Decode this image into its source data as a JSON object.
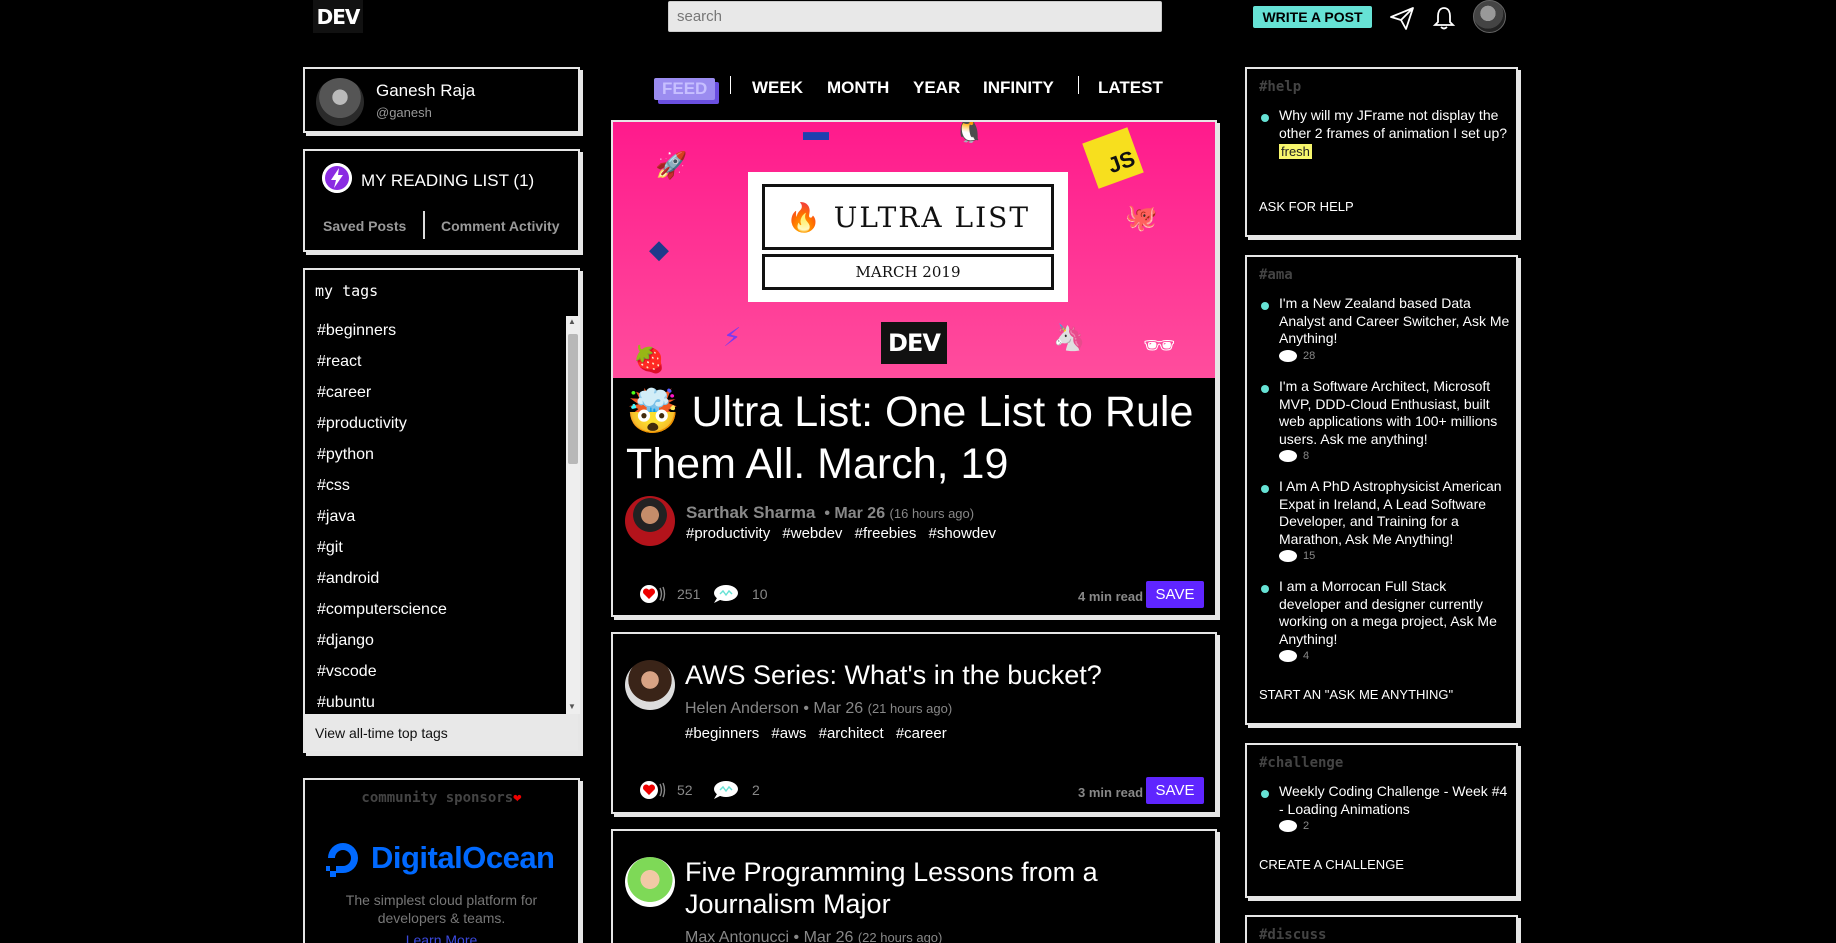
{
  "topbar": {
    "logo": "DEV",
    "search_placeholder": "search",
    "write_post": "WRITE A POST",
    "icons": [
      "paper-plane-icon",
      "bell-icon",
      "avatar"
    ]
  },
  "profile": {
    "name": "Ganesh Raja",
    "handle": "@ganesh"
  },
  "reading_list": {
    "title": "MY READING LIST (1)",
    "tabs": [
      "Saved Posts",
      "Comment Activity"
    ]
  },
  "tags": {
    "header": "my tags",
    "items": [
      "#beginners",
      "#react",
      "#career",
      "#productivity",
      "#python",
      "#css",
      "#java",
      "#git",
      "#android",
      "#computerscience",
      "#django",
      "#vscode",
      "#ubuntu"
    ],
    "footer": "View all-time top tags"
  },
  "sponsor": {
    "header": "community sponsors",
    "brand": "DigitalOcean",
    "description_line1": "The simplest cloud platform for",
    "description_line2": "developers & teams.",
    "link": "Learn More"
  },
  "feed_nav": [
    "FEED",
    "WEEK",
    "MONTH",
    "YEAR",
    "INFINITY",
    "LATEST"
  ],
  "banner": {
    "title": "ULTRA LIST",
    "subtitle": "MARCH 2019",
    "badge": "DEV",
    "js": "JS"
  },
  "articles": [
    {
      "title": "🤯 Ultra List: One List to Rule Them All. March, 19",
      "author": "Sarthak Sharma",
      "date": "• Mar 26",
      "ago": "(16 hours ago)",
      "tags": [
        "#productivity",
        "#webdev",
        "#freebies",
        "#showdev"
      ],
      "reactions": "251",
      "comments": "10",
      "read_time": "4 min read",
      "save": "SAVE"
    },
    {
      "title": "AWS Series: What's in the bucket?",
      "author": "Helen Anderson",
      "date": "• Mar 26",
      "ago": "(21 hours ago)",
      "tags": [
        "#beginners",
        "#aws",
        "#architect",
        "#career"
      ],
      "reactions": "52",
      "comments": "2",
      "read_time": "3 min read",
      "save": "SAVE"
    },
    {
      "title": "Five Programming Lessons from a Journalism Major",
      "author": "Max Antonucci",
      "date": "• Mar 26",
      "ago": "(22 hours ago)"
    }
  ],
  "sidebar": {
    "help": {
      "header": "#help",
      "items": [
        {
          "text": "Why will my JFrame not display the other 2 frames of animation I set up?",
          "badge": "fresh"
        }
      ],
      "cta": "ASK FOR HELP"
    },
    "ama": {
      "header": "#ama",
      "items": [
        {
          "text": "I'm a New Zealand based Data Analyst and Career Switcher, Ask Me Anything!",
          "count": "28"
        },
        {
          "text": "I'm a Software Architect, Microsoft MVP, DDD-Cloud Enthusiast, built web applications with 100+ millions users. Ask me anything!",
          "count": "8"
        },
        {
          "text": "I Am A PhD Astrophysicist American Expat in Ireland, A Lead Software Developer, and Training for a Marathon, Ask Me Anything!",
          "count": "15"
        },
        {
          "text": "I am a Morrocan Full Stack developer and designer currently working on a mega project, Ask Me Anything!",
          "count": "4"
        }
      ],
      "cta": "START AN \"ASK ME ANYTHING\""
    },
    "challenge": {
      "header": "#challenge",
      "items": [
        {
          "text": "Weekly Coding Challenge - Week #4 - Loading Animations",
          "count": "2"
        }
      ],
      "cta": "CREATE A CHALLENGE"
    },
    "discuss": {
      "header": "#discuss"
    }
  },
  "colors": {
    "accent": "#5f25ff",
    "teal": "#66e2d5",
    "banner_pink": "#ff1a8c",
    "digitalocean": "#0069ff"
  }
}
